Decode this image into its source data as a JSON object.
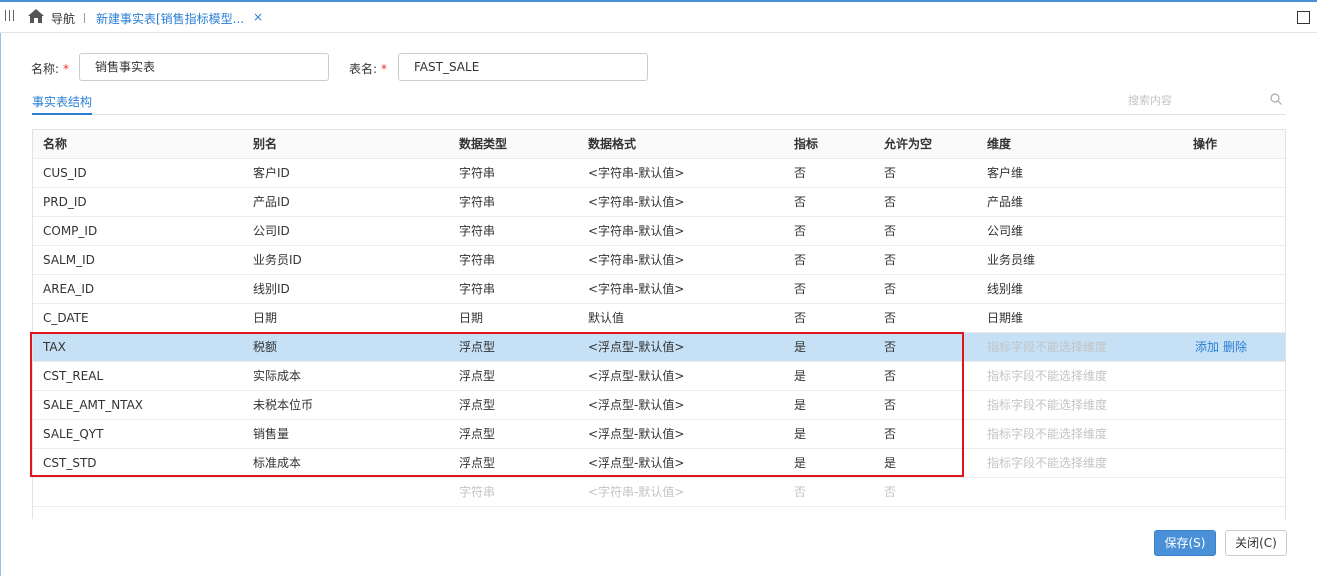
{
  "topbar": {
    "nav_label": "导航",
    "tab_title": "新建事实表[销售指标模型...",
    "tab_close": "×"
  },
  "form": {
    "name_label": "名称:",
    "name_required": "*",
    "name_value": "销售事实表",
    "table_label": "表名:",
    "table_required": "*",
    "table_value": "FAST_SALE"
  },
  "structure_tab": "事实表结构",
  "search": {
    "placeholder": "搜索内容"
  },
  "table": {
    "columns": [
      "名称",
      "别名",
      "数据类型",
      "数据格式",
      "指标",
      "允许为空",
      "维度",
      "操作"
    ],
    "rows": [
      {
        "name": "CUS_ID",
        "alias": "客户ID",
        "type": "字符串",
        "format": "<字符串-默认值>",
        "metric": "否",
        "nullable": "否",
        "dimension": "客户维"
      },
      {
        "name": "PRD_ID",
        "alias": "产品ID",
        "type": "字符串",
        "format": "<字符串-默认值>",
        "metric": "否",
        "nullable": "否",
        "dimension": "产品维"
      },
      {
        "name": "COMP_ID",
        "alias": "公司ID",
        "type": "字符串",
        "format": "<字符串-默认值>",
        "metric": "否",
        "nullable": "否",
        "dimension": "公司维"
      },
      {
        "name": "SALM_ID",
        "alias": "业务员ID",
        "type": "字符串",
        "format": "<字符串-默认值>",
        "metric": "否",
        "nullable": "否",
        "dimension": "业务员维"
      },
      {
        "name": "AREA_ID",
        "alias": "线别ID",
        "type": "字符串",
        "format": "<字符串-默认值>",
        "metric": "否",
        "nullable": "否",
        "dimension": "线别维"
      },
      {
        "name": "C_DATE",
        "alias": "日期",
        "type": "日期",
        "format": "默认值",
        "metric": "否",
        "nullable": "否",
        "dimension": "日期维"
      },
      {
        "name": "TAX",
        "alias": "税额",
        "type": "浮点型",
        "format": "<浮点型-默认值>",
        "metric": "是",
        "nullable": "否",
        "dimension": "指标字段不能选择维度",
        "op_add": "添加",
        "op_delete": "删除"
      },
      {
        "name": "CST_REAL",
        "alias": "实际成本",
        "type": "浮点型",
        "format": "<浮点型-默认值>",
        "metric": "是",
        "nullable": "否",
        "dimension": "指标字段不能选择维度"
      },
      {
        "name": "SALE_AMT_NTAX",
        "alias": "未税本位币",
        "type": "浮点型",
        "format": "<浮点型-默认值>",
        "metric": "是",
        "nullable": "否",
        "dimension": "指标字段不能选择维度"
      },
      {
        "name": "SALE_QYT",
        "alias": "销售量",
        "type": "浮点型",
        "format": "<浮点型-默认值>",
        "metric": "是",
        "nullable": "否",
        "dimension": "指标字段不能选择维度"
      },
      {
        "name": "CST_STD",
        "alias": "标准成本",
        "type": "浮点型",
        "format": "<浮点型-默认值>",
        "metric": "是",
        "nullable": "是",
        "dimension": "指标字段不能选择维度"
      }
    ],
    "new_row": {
      "type": "字符串",
      "format": "<字符串-默认值>",
      "metric": "否",
      "nullable": "否"
    }
  },
  "buttons": {
    "save": "保存(S)",
    "close": "关闭(C)"
  },
  "colors": {
    "accent": "#2a7fd4",
    "selected_row": "#c6e0f5",
    "highlight_border": "#e0141b",
    "save_button": "#4a90d9"
  }
}
